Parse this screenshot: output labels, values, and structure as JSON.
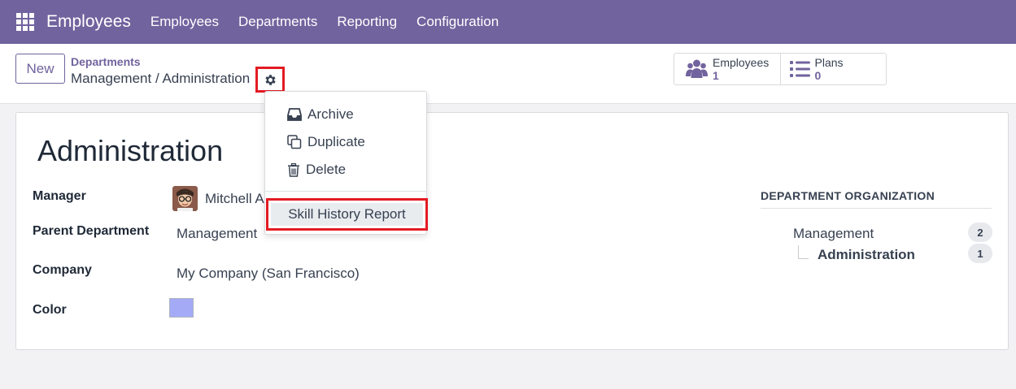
{
  "navbar": {
    "app_name": "Employees",
    "menu": [
      "Employees",
      "Departments",
      "Reporting",
      "Configuration"
    ],
    "color": "#71639e"
  },
  "control": {
    "new_label": "New",
    "breadcrumb_parent": "Departments",
    "breadcrumb_current": "Management / Administration",
    "stats": {
      "employees": {
        "label": "Employees",
        "value": "1"
      },
      "plans": {
        "label": "Plans",
        "value": "0"
      }
    }
  },
  "actions_menu": {
    "items": [
      "Archive",
      "Duplicate",
      "Delete"
    ],
    "report": "Skill History Report",
    "highlight_color": "#e31b23"
  },
  "form": {
    "title": "Administration",
    "fields": {
      "manager_label": "Manager",
      "manager_value": "Mitchell A",
      "parent_label": "Parent Department",
      "parent_value": "Management",
      "company_label": "Company",
      "company_value": "My Company (San Francisco)",
      "color_label": "Color",
      "color_value": "#a5aaf7"
    },
    "organization": {
      "title": "DEPARTMENT ORGANIZATION",
      "rows": [
        {
          "name": "Management",
          "count": "2"
        },
        {
          "name": "Administration",
          "count": "1"
        }
      ]
    }
  }
}
